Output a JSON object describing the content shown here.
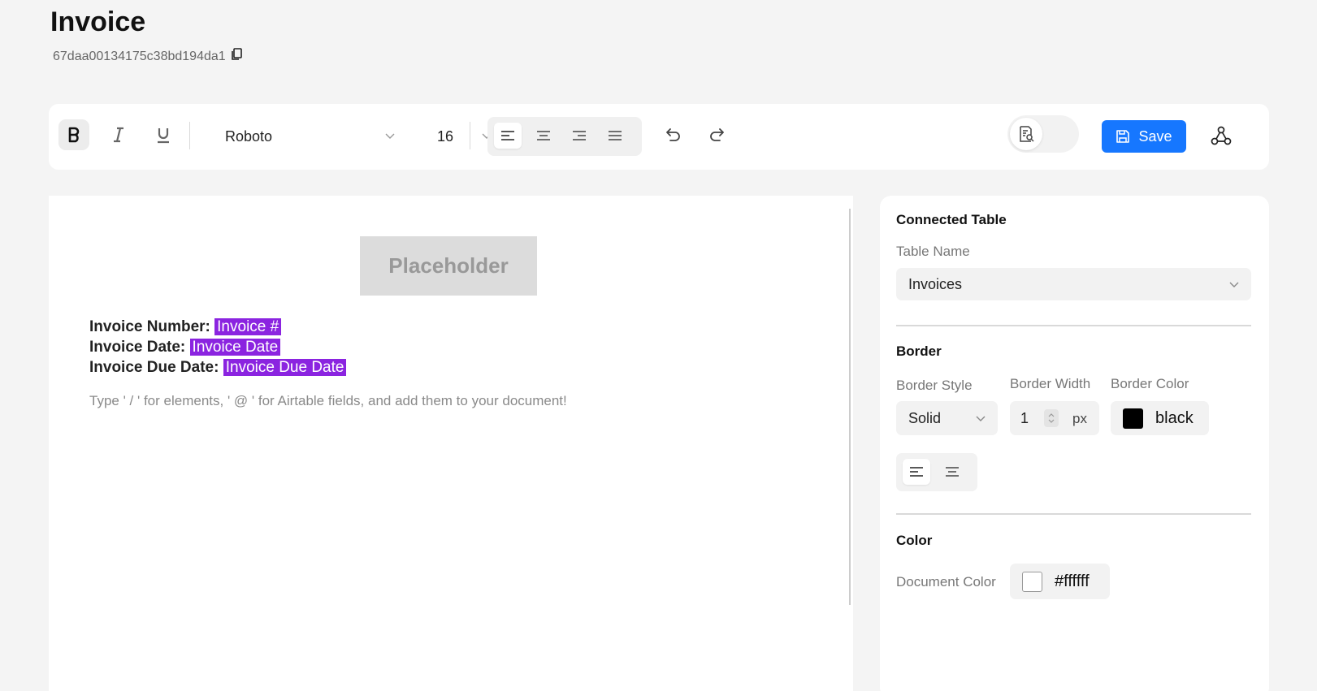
{
  "page": {
    "title": "Invoice",
    "doc_id": "67daa00134175c38bd194da1"
  },
  "toolbar": {
    "font_family": "Roboto",
    "font_size": "16",
    "save_label": "Save",
    "accent_color": "#1677ff"
  },
  "editor": {
    "placeholder_label": "Placeholder",
    "fields": [
      {
        "label": "Invoice Number:",
        "value": "Invoice #"
      },
      {
        "label": "Invoice Date:",
        "value": "Invoice Date"
      },
      {
        "label": "Invoice Due Date:",
        "value": "Invoice Due Date"
      }
    ],
    "field_chip_color": "#8b24e0",
    "hint": "Type ' / ' for elements, ' @ ' for Airtable fields, and add them to your document!"
  },
  "panel": {
    "connected_table": {
      "title": "Connected Table",
      "table_name_label": "Table Name",
      "table_name_value": "Invoices"
    },
    "border": {
      "title": "Border",
      "style_label": "Border Style",
      "style_value": "Solid",
      "width_label": "Border Width",
      "width_value": "1",
      "width_unit": "px",
      "color_label": "Border Color",
      "color_value": "black",
      "color_hex": "#000000"
    },
    "color": {
      "title": "Color",
      "document_color_label": "Document Color",
      "document_color_value": "#ffffff"
    }
  }
}
